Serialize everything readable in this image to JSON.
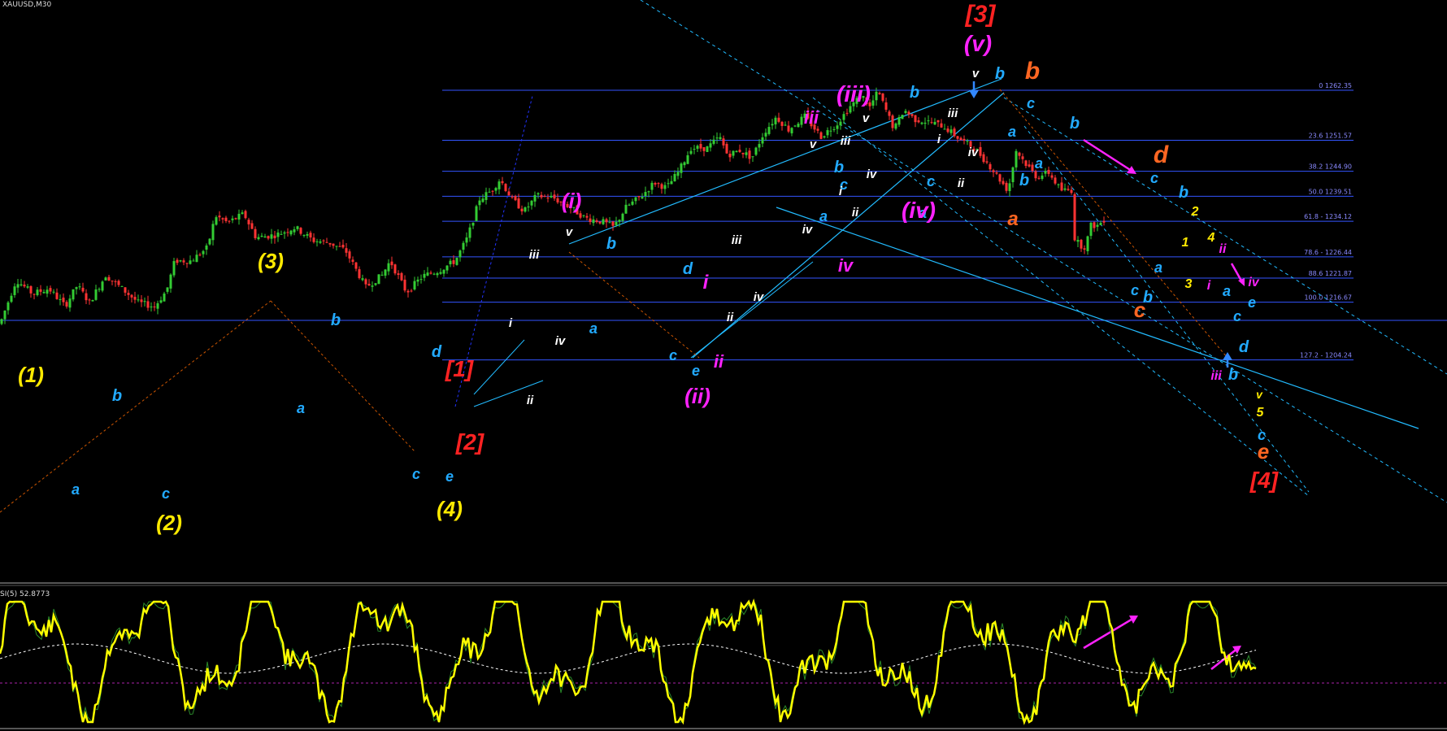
{
  "header": {
    "symbol": "XAUUSD,M30"
  },
  "indicator": {
    "title": "SI(5) 52.8773"
  },
  "fib_levels": [
    {
      "label": "0 1262.35",
      "price": 1262.35
    },
    {
      "label": "23.6 1251.57",
      "price": 1251.57
    },
    {
      "label": "38.2 1244.90",
      "price": 1244.9
    },
    {
      "label": "50.0 1239.51",
      "price": 1239.51
    },
    {
      "label": "61.8 - 1234.12",
      "price": 1234.12
    },
    {
      "label": "78.6 - 1226.44",
      "price": 1226.44
    },
    {
      "label": "88.6 1221.87",
      "price": 1221.87
    },
    {
      "label": "100.0 1216.67",
      "price": 1216.67
    },
    {
      "label": "127.2 - 1204.24",
      "price": 1204.24
    }
  ],
  "colors": {
    "background": "#000000",
    "bull_candle": "#33cc33",
    "bear_candle": "#ff3333",
    "fib_line": "#3355ff",
    "channel": "#22bbff",
    "yellow": "#ffea00",
    "cyan": "#22aaff",
    "magenta": "#ff22ff",
    "red": "#ff2222",
    "orange": "#ff6622",
    "white": "#ffffff",
    "oscillator": "#ffff00"
  },
  "chart_data": {
    "type": "candlestick",
    "symbol": "XAUUSD",
    "timeframe": "M30",
    "ylim": [
      1198,
      1274
    ],
    "price_path": [
      [
        0,
        1212
      ],
      [
        20,
        1221.5
      ],
      [
        40,
        1218.5
      ],
      [
        60,
        1219.6
      ],
      [
        80,
        1215.8
      ],
      [
        95,
        1220.3
      ],
      [
        110,
        1216.6
      ],
      [
        130,
        1222.5
      ],
      [
        150,
        1219.6
      ],
      [
        170,
        1216.6
      ],
      [
        190,
        1215.7
      ],
      [
        205,
        1219.2
      ],
      [
        215,
        1225.6
      ],
      [
        235,
        1225.6
      ],
      [
        255,
        1228.4
      ],
      [
        265,
        1235.3
      ],
      [
        280,
        1233.8
      ],
      [
        300,
        1235.7
      ],
      [
        315,
        1230.6
      ],
      [
        340,
        1231.2
      ],
      [
        363,
        1232.8
      ],
      [
        385,
        1230
      ],
      [
        405,
        1229.5
      ],
      [
        425,
        1227.8
      ],
      [
        450,
        1219.9
      ],
      [
        470,
        1222.5
      ],
      [
        480,
        1225.6
      ],
      [
        500,
        1218.8
      ],
      [
        520,
        1222.3
      ],
      [
        540,
        1223.5
      ],
      [
        560,
        1225.6
      ],
      [
        575,
        1230.6
      ],
      [
        590,
        1238.9
      ],
      [
        605,
        1240.8
      ],
      [
        615,
        1243.2
      ],
      [
        630,
        1238.8
      ],
      [
        645,
        1236.3
      ],
      [
        660,
        1239.6
      ],
      [
        680,
        1239.2
      ],
      [
        700,
        1237.3
      ],
      [
        720,
        1234.8
      ],
      [
        740,
        1234.1
      ],
      [
        755,
        1232.8
      ],
      [
        770,
        1237.1
      ],
      [
        790,
        1239.7
      ],
      [
        805,
        1242.5
      ],
      [
        820,
        1241.3
      ],
      [
        835,
        1244.9
      ],
      [
        850,
        1249.9
      ],
      [
        870,
        1249.9
      ],
      [
        885,
        1252.3
      ],
      [
        895,
        1248.4
      ],
      [
        910,
        1249.4
      ],
      [
        925,
        1247.8
      ],
      [
        940,
        1253.3
      ],
      [
        955,
        1256.6
      ],
      [
        970,
        1253.9
      ],
      [
        990,
        1256.7
      ],
      [
        1010,
        1252.4
      ],
      [
        1030,
        1255.2
      ],
      [
        1045,
        1258.7
      ],
      [
        1060,
        1261.3
      ],
      [
        1070,
        1258.7
      ],
      [
        1080,
        1262.1
      ],
      [
        1090,
        1258
      ],
      [
        1100,
        1253.9
      ],
      [
        1112,
        1258.2
      ],
      [
        1125,
        1256.1
      ],
      [
        1140,
        1255.6
      ],
      [
        1160,
        1254.7
      ],
      [
        1180,
        1251.9
      ],
      [
        1200,
        1249.7
      ],
      [
        1220,
        1245.5
      ],
      [
        1240,
        1240.7
      ],
      [
        1250,
        1249.4
      ],
      [
        1262,
        1246.5
      ],
      [
        1275,
        1243.7
      ],
      [
        1290,
        1244.6
      ],
      [
        1305,
        1240.8
      ],
      [
        1318,
        1240.8
      ],
      [
        1322,
        1230.5
      ],
      [
        1328,
        1229
      ],
      [
        1335,
        1228.6
      ],
      [
        1342,
        1233.2
      ],
      [
        1350,
        1233.2
      ],
      [
        1358,
        1234.5
      ]
    ],
    "wave_labels": [
      {
        "text": "(1)",
        "color": "yellow"
      },
      {
        "text": "(2)",
        "color": "yellow"
      },
      {
        "text": "(3)",
        "color": "yellow"
      },
      {
        "text": "(4)",
        "color": "yellow"
      },
      {
        "text": "a",
        "color": "cyan"
      },
      {
        "text": "b",
        "color": "cyan"
      },
      {
        "text": "c",
        "color": "cyan"
      },
      {
        "text": "d",
        "color": "cyan"
      },
      {
        "text": "e",
        "color": "cyan"
      },
      {
        "text": "[1]",
        "color": "red"
      },
      {
        "text": "[2]",
        "color": "red"
      },
      {
        "text": "[3]",
        "color": "red"
      },
      {
        "text": "[4]",
        "color": "red"
      },
      {
        "text": "(i)",
        "color": "magenta"
      },
      {
        "text": "(ii)",
        "color": "magenta"
      },
      {
        "text": "(iii)",
        "color": "magenta"
      },
      {
        "text": "(iv)",
        "color": "magenta"
      },
      {
        "text": "(v)",
        "color": "magenta"
      },
      {
        "text": "i",
        "color": "white"
      },
      {
        "text": "ii",
        "color": "white"
      },
      {
        "text": "iii",
        "color": "white"
      },
      {
        "text": "iv",
        "color": "white"
      },
      {
        "text": "v",
        "color": "white"
      },
      {
        "text": "1",
        "color": "yellow"
      },
      {
        "text": "2",
        "color": "yellow"
      },
      {
        "text": "3",
        "color": "yellow"
      },
      {
        "text": "4",
        "color": "yellow"
      },
      {
        "text": "5",
        "color": "yellow"
      }
    ],
    "oscillator": {
      "name": "SI(5)",
      "value": 52.8773
    }
  }
}
